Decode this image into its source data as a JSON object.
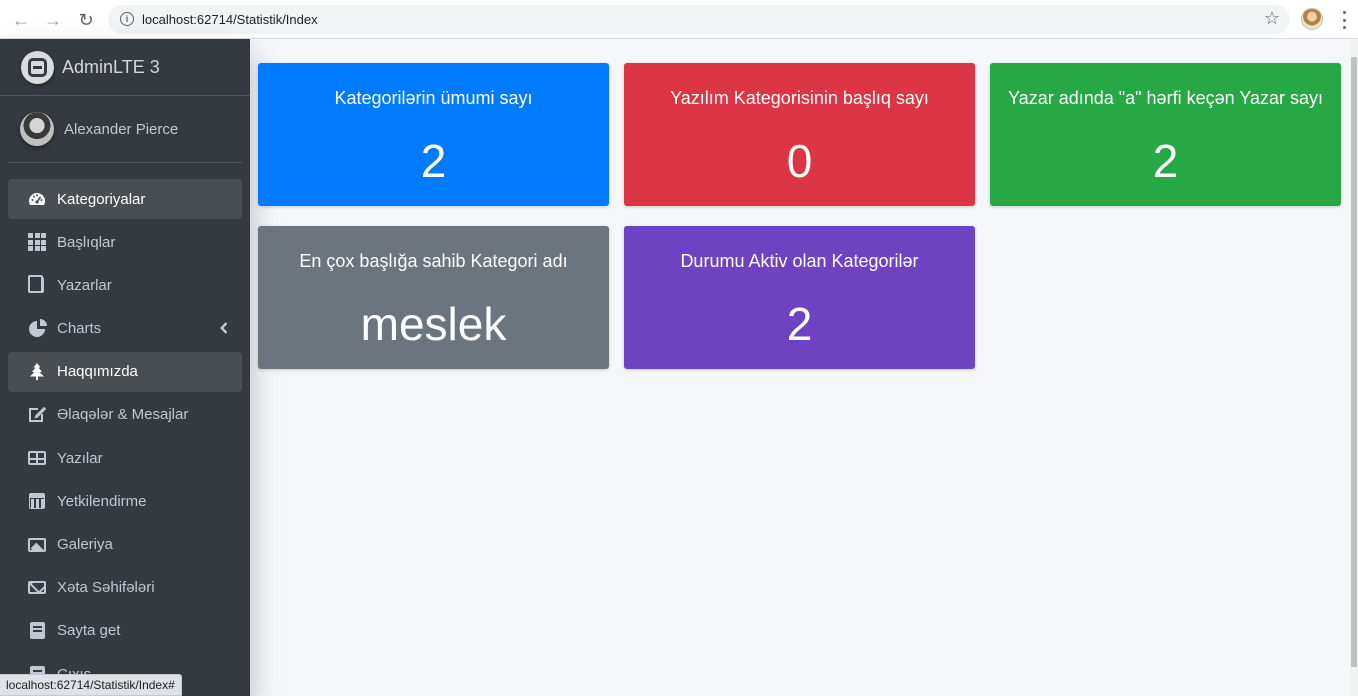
{
  "browser": {
    "url": "localhost:62714/Statistik/Index",
    "status_url": "localhost:62714/Statistik/Index#"
  },
  "sidebar": {
    "brand": "AdminLTE 3",
    "user_name": "Alexander Pierce",
    "items": [
      {
        "label": "Kategoriyalar",
        "icon": "tachometer-icon",
        "active": true
      },
      {
        "label": "Başlıqlar",
        "icon": "grid-icon",
        "active": false
      },
      {
        "label": "Yazarlar",
        "icon": "copy-icon",
        "active": false
      },
      {
        "label": "Charts",
        "icon": "pie-chart-icon",
        "active": false,
        "has_submenu": true
      },
      {
        "label": "Haqqımızda",
        "icon": "tree-icon",
        "active": true
      },
      {
        "label": "Əlaqələr & Mesajlar",
        "icon": "edit-icon",
        "active": false
      },
      {
        "label": "Yazılar",
        "icon": "table-icon",
        "active": false
      },
      {
        "label": "Yetkilendirme",
        "icon": "calendar-icon",
        "active": false
      },
      {
        "label": "Galeriya",
        "icon": "image-icon",
        "active": false
      },
      {
        "label": "Xəta Səhifələri",
        "icon": "envelope-icon",
        "active": false
      },
      {
        "label": "Sayta get",
        "icon": "book-icon",
        "active": false
      },
      {
        "label": "Çıxış",
        "icon": "book-icon",
        "active": false
      }
    ]
  },
  "stats": [
    {
      "title": "Kategorilərin ümumi sayı",
      "value": "2",
      "color": "#007bff"
    },
    {
      "title": "Yazılım Kategorisinin başlıq sayı",
      "value": "0",
      "color": "#dc3545"
    },
    {
      "title": "Yazar adında \"a\" hərfi keçən Yazar sayı",
      "value": "2",
      "color": "#28a745"
    },
    {
      "title": "En çox başlığa sahib Kategori adı",
      "value": "meslek",
      "color": "#6c757d"
    },
    {
      "title": "Durumu Aktiv olan Kategorilər",
      "value": "2",
      "color": "#6f42c1"
    }
  ]
}
